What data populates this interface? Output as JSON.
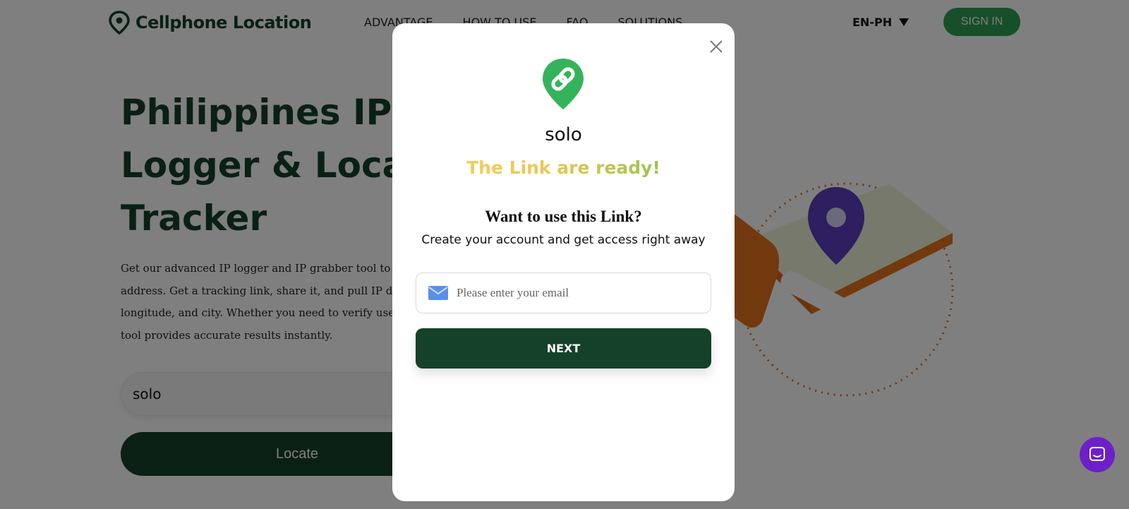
{
  "header": {
    "brand": "Cellphone Location",
    "nav": [
      {
        "label": "ADVANTAGE"
      },
      {
        "label": "HOW TO USE"
      },
      {
        "label": "FAQ"
      },
      {
        "label": "SOLUTIONS"
      }
    ],
    "language": "EN-PH",
    "signin_label": "SIGN IN"
  },
  "hero": {
    "title": "Philippines IP Logger & Location Tracker",
    "description": "Get our advanced IP logger and IP grabber tool to easily track any IP address. Get a tracking link, share it, and pull IP details like location, longitude, and city. Whether you need to verify users or collect one, our tool provides accurate results instantly.",
    "input_value": "solo",
    "locate_label": "Locate"
  },
  "modal": {
    "name": "solo",
    "ready_text": "The Link are ready!",
    "question": "Want to use this Link?",
    "subtitle": "Create your account and get access right away",
    "email_placeholder": "Please enter your email",
    "next_label": "NEXT"
  },
  "colors": {
    "brand_dark": "#15402a",
    "brand_green": "#2e9e55",
    "ready_gradient_start": "#f3cd57",
    "ready_gradient_end": "#9bc452",
    "chat": "#6d20c8"
  },
  "icons": {
    "brand_logo": "location-pin-icon",
    "modal_logo": "link-pin-icon",
    "close": "close-icon",
    "email": "envelope-icon",
    "chat": "chat-icon"
  }
}
